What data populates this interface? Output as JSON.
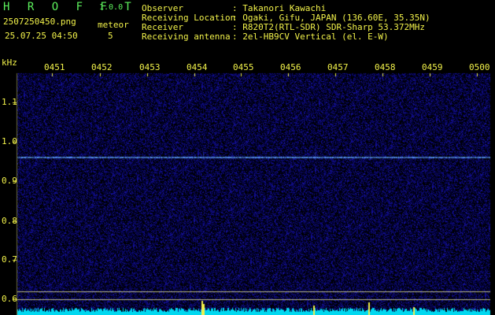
{
  "app": {
    "name": "H R O F F T",
    "version": "1.0.0"
  },
  "file": {
    "name": "2507250450.png",
    "datetime": "25.07.25 04:50"
  },
  "meteor": {
    "label": "meteor",
    "count": "5"
  },
  "info": [
    {
      "label": "Observer",
      "value": ": Takanori Kawachi"
    },
    {
      "label": "Receiving Location",
      "value": ": Ogaki, Gifu, JAPAN (136.60E, 35.35N)"
    },
    {
      "label": "Receiver",
      "value": ": R820T2(RTL-SDR) SDR-Sharp 53.372MHz"
    },
    {
      "label": "Receiving antenna",
      "value": ": 2el-HB9CV Vertical (el. E-W)"
    }
  ],
  "axis": {
    "unit": "kHz",
    "y_ticks": [
      "1.1",
      "1.0",
      "0.9",
      "0.8",
      "0.7",
      "0.6"
    ],
    "x_ticks": [
      "0451",
      "0452",
      "0453",
      "0454",
      "0455",
      "0456",
      "0457",
      "0458",
      "0459",
      "0500"
    ]
  },
  "colors": {
    "header_text": "#f2f24a",
    "app_text": "#5cf05c",
    "background": "#000000",
    "noise": "#1a1a8c",
    "carrier": "#66aaff",
    "spectrum": "#00e5ff",
    "meteor_marks": "#f2f24a"
  }
}
